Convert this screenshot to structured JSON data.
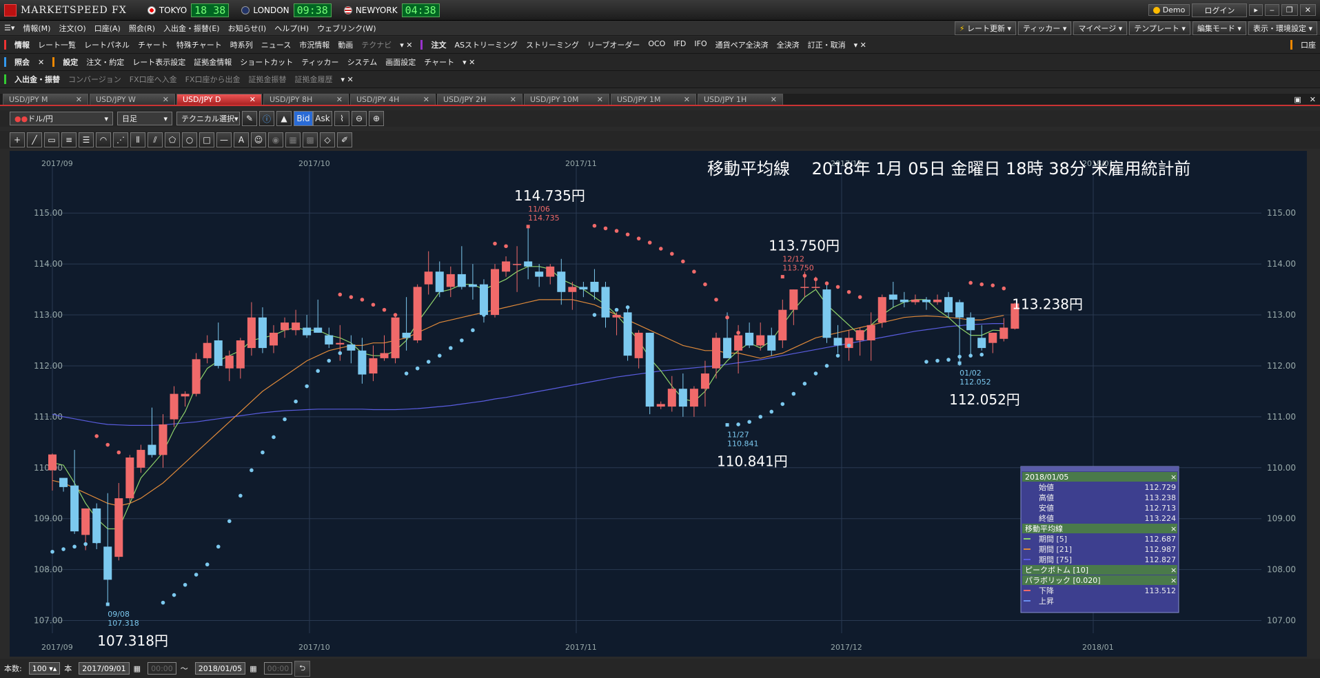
{
  "app": {
    "name": "MARKETSPEED FX"
  },
  "clocks": [
    {
      "city": "TOKYO",
      "time": "18 38"
    },
    {
      "city": "LONDON",
      "time": "09:38"
    },
    {
      "city": "NEWYORK",
      "time": "04:38"
    }
  ],
  "window": {
    "demo": "Demo",
    "login": "ログイン"
  },
  "menu": {
    "items": [
      "情報(M)",
      "注文(O)",
      "口座(A)",
      "照会(R)",
      "入出金・振替(E)",
      "お知らせ(I)",
      "ヘルプ(H)",
      "ウェブリンク(W)"
    ],
    "right": [
      "レート更新",
      "ティッカー",
      "マイページ",
      "テンプレート",
      "編集モード",
      "表示・環境設定"
    ]
  },
  "row1": {
    "group1": "情報",
    "items1": [
      "レート一覧",
      "レートパネル",
      "チャート",
      "特殊チャート",
      "時系列",
      "ニュース",
      "市況情報",
      "動画",
      "テクナビ"
    ],
    "group2": "注文",
    "items2": [
      "ASストリーミング",
      "ストリーミング",
      "リーブオーダー",
      "OCO",
      "IFD",
      "IFO",
      "通貨ペア全決済",
      "全決済",
      "訂正・取消"
    ],
    "right": "口座"
  },
  "row2": {
    "group1": "照会",
    "group2": "設定",
    "items2": [
      "注文・約定",
      "レート表示設定",
      "証拠金情報",
      "ショートカット",
      "ティッカー",
      "システム",
      "画面設定",
      "チャート"
    ]
  },
  "row3": {
    "group1": "入出金・振替",
    "items": [
      "コンバージョン",
      "FX口座へ入金",
      "FX口座から出金",
      "証拠金振替",
      "証拠金履歴"
    ]
  },
  "tabs": [
    {
      "label": "USD/JPY M",
      "active": false
    },
    {
      "label": "USD/JPY W",
      "active": false
    },
    {
      "label": "USD/JPY D",
      "active": true
    },
    {
      "label": "USD/JPY 8H",
      "active": false
    },
    {
      "label": "USD/JPY 4H",
      "active": false
    },
    {
      "label": "USD/JPY 2H",
      "active": false
    },
    {
      "label": "USD/JPY 10M",
      "active": false
    },
    {
      "label": "USD/JPY 1M",
      "active": false
    },
    {
      "label": "USD/JPY 1H",
      "active": false
    }
  ],
  "toolbar": {
    "pair": "ドル/円",
    "interval": "日足",
    "technical": "テクニカル選択",
    "bid": "Bid",
    "ask": "Ask"
  },
  "bottom": {
    "count_label": "本数:",
    "count": "100",
    "unit": "本",
    "from": "2017/09/01",
    "time_from": "00:00",
    "tilde": "〜",
    "to": "2018/01/05",
    "time_to": "00:00"
  },
  "chart_data": {
    "type": "candlestick",
    "title": "移動平均線　 2018年 1月 05日 金曜日 18時 38分 米雇用統計前",
    "y_ticks": [
      "115.00",
      "114.00",
      "113.00",
      "112.00",
      "111.00",
      "110.00",
      "109.00",
      "108.00",
      "107.00"
    ],
    "ylim": [
      106.75,
      115.95
    ],
    "top_x_labels": [
      "2017/09",
      "2017/10",
      "2017/11",
      "2017/12",
      "2018/01"
    ],
    "bottom_x_labels": [
      "2017/09",
      "2017/10",
      "2017/11",
      "2017/12",
      "2018/01"
    ],
    "candles": [
      [
        109.95,
        110.28,
        109.55,
        110.26
      ],
      [
        109.8,
        109.68,
        109.53,
        109.62
      ],
      [
        109.65,
        110.35,
        108.7,
        108.75
      ],
      [
        108.68,
        109.2,
        108.38,
        109.2
      ],
      [
        109.2,
        109.3,
        108.4,
        108.52
      ],
      [
        108.45,
        109.5,
        107.32,
        107.8
      ],
      [
        108.25,
        109.7,
        108.18,
        109.4
      ],
      [
        109.4,
        110.25,
        109.3,
        110.2
      ],
      [
        110.0,
        110.45,
        109.9,
        110.35
      ],
      [
        110.45,
        111.18,
        110.2,
        110.25
      ],
      [
        110.25,
        111.05,
        110.0,
        110.85
      ],
      [
        110.95,
        111.6,
        110.8,
        111.45
      ],
      [
        111.4,
        111.5,
        111.2,
        111.45
      ],
      [
        111.45,
        112.25,
        111.4,
        112.13
      ],
      [
        112.15,
        112.6,
        112.05,
        112.45
      ],
      [
        112.5,
        112.85,
        111.95,
        112.0
      ],
      [
        111.95,
        112.3,
        111.7,
        112.2
      ],
      [
        111.95,
        112.55,
        111.75,
        112.5
      ],
      [
        112.35,
        113.25,
        112.2,
        112.95
      ],
      [
        112.95,
        113.15,
        112.25,
        112.35
      ],
      [
        112.4,
        112.8,
        112.25,
        112.65
      ],
      [
        112.7,
        112.95,
        112.55,
        112.85
      ],
      [
        112.7,
        113.1,
        112.6,
        112.85
      ],
      [
        112.75,
        113.0,
        112.55,
        112.6
      ],
      [
        112.75,
        113.3,
        112.65,
        112.65
      ],
      [
        112.6,
        112.75,
        112.35,
        112.42
      ],
      [
        112.42,
        112.8,
        112.1,
        112.45
      ],
      [
        112.42,
        112.6,
        112.05,
        112.3
      ],
      [
        112.3,
        112.55,
        111.65,
        111.83
      ],
      [
        111.85,
        112.4,
        111.7,
        112.15
      ],
      [
        112.15,
        112.6,
        112.1,
        112.25
      ],
      [
        112.15,
        113.0,
        112.05,
        112.95
      ],
      [
        112.65,
        113.35,
        112.3,
        112.55
      ],
      [
        112.5,
        113.6,
        112.45,
        113.55
      ],
      [
        113.6,
        114.25,
        113.4,
        113.85
      ],
      [
        113.85,
        114.05,
        113.35,
        113.45
      ],
      [
        113.55,
        113.95,
        113.35,
        113.8
      ],
      [
        113.8,
        114.35,
        113.5,
        113.55
      ],
      [
        113.6,
        114.0,
        113.3,
        113.55
      ],
      [
        113.6,
        113.7,
        112.85,
        113.0
      ],
      [
        113.0,
        114.0,
        112.95,
        113.9
      ],
      [
        113.85,
        114.15,
        113.75,
        114.05
      ],
      [
        114.0,
        114.35,
        113.45,
        114.0
      ],
      [
        114.05,
        114.74,
        113.7,
        113.95
      ],
      [
        113.85,
        114.0,
        113.55,
        113.75
      ],
      [
        113.75,
        114.0,
        113.6,
        113.95
      ],
      [
        113.85,
        114.1,
        113.2,
        113.45
      ],
      [
        113.45,
        113.65,
        113.1,
        113.55
      ],
      [
        113.55,
        113.65,
        113.35,
        113.5
      ],
      [
        113.65,
        113.9,
        113.3,
        113.45
      ],
      [
        113.55,
        113.65,
        112.75,
        112.95
      ],
      [
        112.95,
        113.05,
        112.6,
        113.0
      ],
      [
        113.05,
        113.15,
        112.1,
        112.2
      ],
      [
        112.15,
        112.7,
        111.95,
        112.65
      ],
      [
        112.65,
        112.65,
        111.05,
        111.2
      ],
      [
        111.2,
        111.3,
        111.15,
        111.25
      ],
      [
        111.2,
        111.8,
        111.1,
        111.55
      ],
      [
        111.55,
        111.85,
        111.0,
        111.2
      ],
      [
        111.2,
        111.6,
        111.0,
        111.55
      ],
      [
        111.55,
        112.1,
        111.2,
        111.85
      ],
      [
        111.95,
        112.65,
        111.75,
        112.55
      ],
      [
        112.55,
        113.05,
        112.35,
        112.15
      ],
      [
        112.3,
        112.8,
        111.85,
        112.6
      ],
      [
        112.65,
        112.85,
        112.35,
        112.4
      ],
      [
        112.4,
        112.85,
        112.3,
        112.6
      ],
      [
        112.6,
        112.75,
        112.2,
        112.3
      ],
      [
        112.5,
        113.3,
        112.35,
        113.1
      ],
      [
        113.1,
        113.5,
        112.8,
        113.5
      ],
      [
        113.55,
        113.85,
        113.35,
        113.55
      ],
      [
        113.55,
        113.75,
        113.5,
        113.55
      ],
      [
        113.5,
        113.65,
        112.45,
        112.55
      ],
      [
        112.55,
        112.8,
        112.25,
        112.4
      ],
      [
        112.35,
        112.7,
        112.1,
        112.55
      ],
      [
        112.5,
        112.75,
        112.2,
        112.7
      ],
      [
        112.5,
        113.05,
        112.1,
        112.8
      ],
      [
        112.85,
        113.4,
        112.75,
        113.35
      ],
      [
        113.4,
        113.65,
        113.15,
        113.3
      ],
      [
        113.3,
        113.45,
        113.15,
        113.25
      ],
      [
        113.25,
        113.4,
        113.2,
        113.3
      ],
      [
        113.3,
        113.35,
        113.1,
        113.25
      ],
      [
        113.25,
        113.4,
        113.2,
        113.3
      ],
      [
        113.35,
        113.45,
        112.95,
        113.05
      ],
      [
        113.25,
        113.3,
        112.0,
        112.95
      ],
      [
        112.95,
        113.05,
        112.2,
        112.7
      ],
      [
        112.55,
        112.8,
        112.3,
        112.35
      ],
      [
        112.45,
        112.6,
        112.25,
        112.65
      ],
      [
        112.53,
        112.94,
        112.48,
        112.75
      ],
      [
        112.729,
        113.238,
        112.713,
        113.224
      ]
    ],
    "sma5": [
      110.1,
      110.05,
      109.7,
      109.3,
      109.0,
      108.8,
      108.8,
      109.3,
      109.8,
      110.05,
      110.3,
      110.75,
      111.1,
      111.6,
      111.95,
      112.1,
      112.2,
      112.3,
      112.5,
      112.55,
      112.6,
      112.7,
      112.75,
      112.7,
      112.7,
      112.6,
      112.55,
      112.45,
      112.25,
      112.2,
      112.2,
      112.3,
      112.5,
      112.85,
      113.15,
      113.45,
      113.5,
      113.6,
      113.6,
      113.5,
      113.6,
      113.7,
      113.85,
      113.95,
      113.95,
      113.9,
      113.7,
      113.6,
      113.5,
      113.35,
      113.2,
      113.0,
      112.75,
      112.5,
      112.15,
      111.9,
      111.6,
      111.35,
      111.3,
      111.5,
      111.85,
      112.1,
      112.3,
      112.45,
      112.35,
      112.5,
      112.8,
      113.1,
      113.35,
      113.5,
      113.2,
      113.0,
      112.8,
      112.6,
      112.8,
      113.0,
      113.15,
      113.25,
      113.3,
      113.3,
      113.1,
      112.95,
      112.75,
      112.6,
      112.6,
      112.7,
      112.69
    ],
    "sma21": [
      109.75,
      109.7,
      109.6,
      109.5,
      109.4,
      109.3,
      109.25,
      109.3,
      109.4,
      109.55,
      109.7,
      109.9,
      110.1,
      110.3,
      110.5,
      110.7,
      110.9,
      111.1,
      111.3,
      111.5,
      111.65,
      111.8,
      111.95,
      112.1,
      112.2,
      112.3,
      112.35,
      112.4,
      112.4,
      112.45,
      112.45,
      112.5,
      112.55,
      112.65,
      112.75,
      112.85,
      112.9,
      112.95,
      113.0,
      113.05,
      113.1,
      113.15,
      113.2,
      113.25,
      113.3,
      113.3,
      113.3,
      113.3,
      113.25,
      113.2,
      113.1,
      113.0,
      112.9,
      112.8,
      112.7,
      112.6,
      112.5,
      112.4,
      112.35,
      112.3,
      112.3,
      112.25,
      112.25,
      112.2,
      112.15,
      112.2,
      112.25,
      112.35,
      112.45,
      112.55,
      112.6,
      112.65,
      112.7,
      112.75,
      112.8,
      112.85,
      112.9,
      112.95,
      112.97,
      112.98,
      112.97,
      112.95,
      112.93,
      112.9,
      112.9,
      112.95,
      112.99
    ],
    "sma75": [
      111.05,
      111.0,
      110.96,
      110.92,
      110.88,
      110.85,
      110.84,
      110.83,
      110.83,
      110.83,
      110.84,
      110.86,
      110.88,
      110.9,
      110.93,
      110.96,
      110.99,
      111.02,
      111.05,
      111.08,
      111.1,
      111.12,
      111.13,
      111.14,
      111.15,
      111.15,
      111.15,
      111.15,
      111.15,
      111.14,
      111.14,
      111.14,
      111.15,
      111.16,
      111.18,
      111.2,
      111.22,
      111.25,
      111.28,
      111.31,
      111.35,
      111.38,
      111.42,
      111.46,
      111.5,
      111.54,
      111.58,
      111.62,
      111.66,
      111.7,
      111.74,
      111.78,
      111.81,
      111.84,
      111.87,
      111.9,
      111.92,
      111.94,
      111.96,
      111.98,
      112.0,
      112.03,
      112.06,
      112.09,
      112.12,
      112.16,
      112.2,
      112.24,
      112.28,
      112.32,
      112.36,
      112.4,
      112.44,
      112.48,
      112.52,
      112.56,
      112.6,
      112.64,
      112.68,
      112.71,
      112.74,
      112.77,
      112.79,
      112.81,
      112.82,
      112.83,
      112.83
    ],
    "sar_down": [
      [
        4,
        110.62
      ],
      [
        5,
        110.45
      ],
      [
        6,
        110.3
      ],
      [
        14,
        0
      ],
      [
        26,
        113.4
      ],
      [
        27,
        113.35
      ],
      [
        28,
        113.3
      ],
      [
        29,
        113.2
      ],
      [
        30,
        113.1
      ],
      [
        31,
        113.0
      ],
      [
        40,
        114.4
      ],
      [
        41,
        114.35
      ],
      [
        49,
        114.75
      ],
      [
        50,
        114.7
      ],
      [
        51,
        114.65
      ],
      [
        52,
        114.58
      ],
      [
        53,
        114.5
      ],
      [
        54,
        114.42
      ],
      [
        55,
        114.3
      ],
      [
        56,
        114.2
      ],
      [
        57,
        114.05
      ],
      [
        58,
        113.85
      ],
      [
        59,
        113.6
      ],
      [
        60,
        113.3
      ],
      [
        61,
        112.95
      ],
      [
        62,
        112.65
      ],
      [
        83,
        113.63
      ],
      [
        84,
        113.6
      ],
      [
        85,
        113.58
      ],
      [
        86,
        113.52
      ],
      [
        68,
        113.77
      ],
      [
        69,
        113.7
      ],
      [
        70,
        113.62
      ],
      [
        71,
        113.55
      ],
      [
        72,
        113.45
      ],
      [
        73,
        113.35
      ]
    ],
    "sar_up": [
      [
        0,
        108.35
      ],
      [
        1,
        108.4
      ],
      [
        2,
        108.45
      ],
      [
        3,
        108.5
      ],
      [
        4,
        108.55
      ],
      [
        10,
        107.35
      ],
      [
        11,
        107.5
      ],
      [
        12,
        107.7
      ],
      [
        13,
        107.9
      ],
      [
        14,
        108.1
      ],
      [
        15,
        108.45
      ],
      [
        16,
        108.95
      ],
      [
        17,
        109.45
      ],
      [
        18,
        109.95
      ],
      [
        19,
        110.3
      ],
      [
        20,
        110.6
      ],
      [
        21,
        110.95
      ],
      [
        22,
        111.3
      ],
      [
        23,
        111.6
      ],
      [
        24,
        111.9
      ],
      [
        25,
        112.1
      ],
      [
        26,
        112.25
      ],
      [
        32,
        111.85
      ],
      [
        33,
        111.95
      ],
      [
        34,
        112.08
      ],
      [
        35,
        112.2
      ],
      [
        36,
        112.35
      ],
      [
        37,
        112.5
      ],
      [
        38,
        112.7
      ],
      [
        39,
        113.0
      ],
      [
        49,
        113.0
      ],
      [
        50,
        113.05
      ],
      [
        51,
        113.1
      ],
      [
        52,
        113.15
      ],
      [
        62,
        110.85
      ],
      [
        63,
        110.9
      ],
      [
        64,
        111.0
      ],
      [
        65,
        111.1
      ],
      [
        66,
        111.25
      ],
      [
        67,
        111.45
      ],
      [
        68,
        111.65
      ],
      [
        69,
        111.85
      ],
      [
        70,
        112.0
      ],
      [
        71,
        112.2
      ],
      [
        72,
        112.4
      ],
      [
        79,
        112.08
      ],
      [
        80,
        112.1
      ],
      [
        81,
        112.12
      ],
      [
        82,
        112.18
      ],
      [
        83,
        112.2
      ],
      [
        84,
        112.22
      ]
    ],
    "annotations": [
      {
        "text": "114.735円",
        "idx": 43,
        "y": 114.735,
        "date": "11/06",
        "val": "114.735",
        "side": "above"
      },
      {
        "text": "113.750円",
        "idx": 66,
        "y": 113.75,
        "date": "12/12",
        "val": "113.750",
        "side": "above"
      },
      {
        "text": "110.841円",
        "idx": 61,
        "y": 110.841,
        "date": "11/27",
        "val": "110.841",
        "side": "below"
      },
      {
        "text": "107.318円",
        "idx": 5,
        "y": 107.318,
        "date": "09/08",
        "val": "107.318",
        "side": "below"
      },
      {
        "text": "112.052円",
        "idx": 82,
        "y": 112.052,
        "date": "01/02",
        "val": "112.052",
        "side": "below"
      },
      {
        "text": "113.238円",
        "idx": 86,
        "y": 113.238,
        "date": "",
        "val": "",
        "side": "right"
      }
    ],
    "legend_box": {
      "date": "2018/01/05",
      "ohlc": [
        {
          "label": "始値",
          "value": "112.729"
        },
        {
          "label": "高値",
          "value": "113.238"
        },
        {
          "label": "安値",
          "value": "112.713"
        },
        {
          "label": "終値",
          "value": "113.224"
        }
      ],
      "ma_title": "移動平均線",
      "ma": [
        {
          "label": "期間 [5]",
          "value": "112.687",
          "color": "#8fd26a"
        },
        {
          "label": "期間 [21]",
          "value": "112.987",
          "color": "#e08a3a"
        },
        {
          "label": "期間 [75]",
          "value": "112.827",
          "color": "#5a5de0"
        }
      ],
      "peak_title": "ピークボトム [10]",
      "sar_title": "パラボリック [0.020]",
      "sar": [
        {
          "label": "下降",
          "value": "113.512",
          "color": "#f06a6a"
        },
        {
          "label": "上昇",
          "value": "",
          "color": "#6a8ff0"
        }
      ]
    },
    "colors": {
      "up": "#f06a6a",
      "down": "#7cc9ef",
      "bg": "#0f1b2c",
      "grid": "#2a3a52"
    }
  }
}
